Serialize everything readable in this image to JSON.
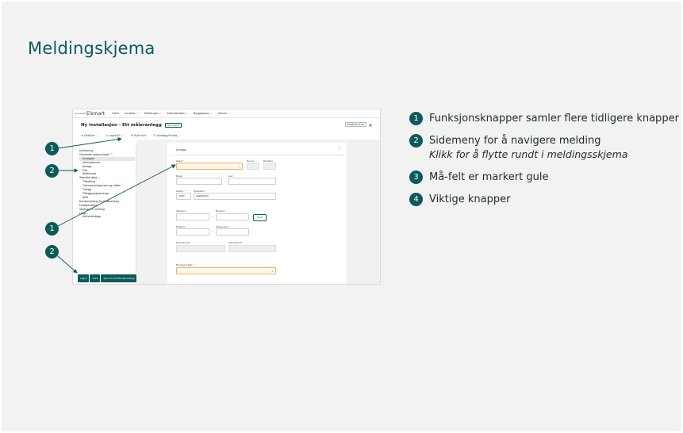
{
  "slide": {
    "title": "Meldingskjema"
  },
  "screenshot": {
    "topbar": {
      "brand_small": "By installer",
      "brand": "Elsmart",
      "nav": [
        "Hjem",
        "Innboks ⌄",
        "Meldinger ⌄",
        "Arbeidsordre ⌄",
        "Byggeplass ⌄",
        "Admin ⌄"
      ]
    },
    "page_title": "Ny installasjon - Ett måleranlegg",
    "page_pill": "Ikke sendt",
    "ref_pill": "P098-0077-23",
    "func_buttons": [
      "≡ Detaljer ⌄",
      "⎙ Lagre/Ut ⌄",
      "⚙ Bytt kort",
      "✎ Vedlegg/Ferdig ⌄"
    ],
    "side_menu": [
      {
        "label": "Innledning",
        "level": 0,
        "selected": false
      },
      {
        "label": "Generelle opplysninger  ^",
        "level": 0,
        "selected": false
      },
      {
        "label": "Anlegget",
        "level": 1,
        "selected": true
      },
      {
        "label": "Verksadresse",
        "level": 1,
        "selected": false
      },
      {
        "label": "Anlegg",
        "level": 1,
        "selected": false
      },
      {
        "label": "Eier",
        "level": 1,
        "selected": false
      },
      {
        "label": "Nettkunde",
        "level": 1,
        "selected": false
      },
      {
        "label": "Tekniske data   ⌄",
        "level": 0,
        "selected": false
      },
      {
        "label": "Tilkobling",
        "level": 1,
        "selected": false
      },
      {
        "label": "Overspenningsvern og måler",
        "level": 1,
        "selected": false
      },
      {
        "label": "Tillegg",
        "level": 1,
        "selected": false
      },
      {
        "label": "Tilleggsopplysninger",
        "level": 1,
        "selected": false
      },
      {
        "label": "AMS",
        "level": 1,
        "selected": false
      },
      {
        "label": "Kundemelding fra Nettselskap",
        "level": 0,
        "selected": false
      },
      {
        "label": "Ferdigmelding",
        "level": 0,
        "selected": false
      },
      {
        "label": "Vedlegg til melding",
        "level": 0,
        "selected": false
      },
      {
        "label": "Logg   ⌄",
        "level": 0,
        "selected": false
      },
      {
        "label": "Aktivitetslogg",
        "level": 1,
        "selected": false
      }
    ],
    "form": {
      "card_title": "Anlegg",
      "gate_label": "Gate *",
      "husnr_label": "Husnr.",
      "bokstav_label": "Bokstav",
      "bygg_label": "Bygg",
      "led_label": "Led",
      "postnr_label": "Postnr. *",
      "poststed_label": "Poststed *",
      "postnr_value": "3063",
      "poststed_value": "GRIMSTAD",
      "gardsnr_label": "Gårdsnr.",
      "bruksnr_label": "Bruksnr.",
      "hent_label": "Hent",
      "festenr_label": "Festenr.",
      "seksjonsnr_label": "Seksjonsnr.",
      "koordinat_n_label": "Koordinat N",
      "koordinat_e_label": "Koordinat E",
      "bruksomrade_label": "Bruksområde *"
    },
    "bottom_buttons": [
      "Lagre",
      "Lukk",
      "Send for forhåndsmelding"
    ]
  },
  "callouts": {
    "badge1_top": "1",
    "badge2_top": "2",
    "badge1_bottom": "1",
    "badge2_bottom": "2"
  },
  "legend": [
    {
      "number": "1",
      "text": "Funksjonsknapper samler flere tidligere knapper",
      "sub": ""
    },
    {
      "number": "2",
      "text": "Sidemeny for å navigere melding",
      "sub": "Klikk for å flytte rundt i meldingsskjema"
    },
    {
      "number": "3",
      "text": "Må-felt er markert gule",
      "sub": ""
    },
    {
      "number": "4",
      "text": "Viktige knapper",
      "sub": ""
    }
  ],
  "colors": {
    "accent": "#0e5a5b",
    "required_border": "#e8b563",
    "required_fill": "#fff8ea",
    "background": "#f2f2f2"
  }
}
